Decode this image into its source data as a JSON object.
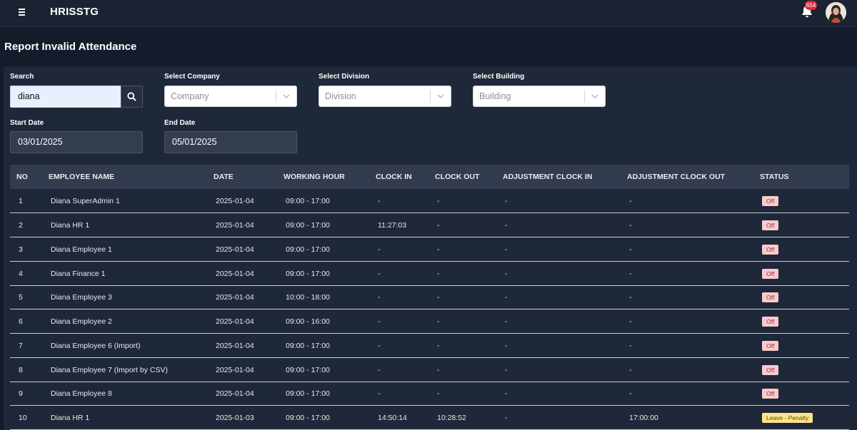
{
  "app": {
    "title": "HRISSTG",
    "notification_count": "654"
  },
  "page": {
    "title": "Report Invalid Attendance"
  },
  "filters": {
    "search": {
      "label": "Search",
      "value": "diana"
    },
    "company": {
      "label": "Select Company",
      "placeholder": "Company"
    },
    "division": {
      "label": "Select Division",
      "placeholder": "Division"
    },
    "building": {
      "label": "Select Building",
      "placeholder": "Building"
    },
    "start_date": {
      "label": "Start Date",
      "value": "03/01/2025"
    },
    "end_date": {
      "label": "End Date",
      "value": "05/01/2025"
    }
  },
  "table": {
    "columns": [
      "NO",
      "EMPLOYEE NAME",
      "DATE",
      "WORKING HOUR",
      "CLOCK IN",
      "CLOCK OUT",
      "ADJUSTMENT CLOCK IN",
      "ADJUSTMENT CLOCK OUT",
      "STATUS"
    ],
    "rows": [
      {
        "no": "1",
        "name": "Diana SuperAdmin 1",
        "date": "2025-01-04",
        "working_hour": "09:00 - 17:00",
        "clock_in": "-",
        "clock_out": "-",
        "adj_in": "-",
        "adj_out": "-",
        "status": "Off",
        "status_type": "off"
      },
      {
        "no": "2",
        "name": "Diana HR 1",
        "date": "2025-01-04",
        "working_hour": "09:00 - 17:00",
        "clock_in": "11:27:03",
        "clock_out": "-",
        "adj_in": "-",
        "adj_out": "-",
        "status": "Off",
        "status_type": "off"
      },
      {
        "no": "3",
        "name": "Diana Employee 1",
        "date": "2025-01-04",
        "working_hour": "09:00 - 17:00",
        "clock_in": "-",
        "clock_out": "-",
        "adj_in": "-",
        "adj_out": "-",
        "status": "Off",
        "status_type": "off"
      },
      {
        "no": "4",
        "name": "Diana Finance 1",
        "date": "2025-01-04",
        "working_hour": "09:00 - 17:00",
        "clock_in": "-",
        "clock_out": "-",
        "adj_in": "-",
        "adj_out": "-",
        "status": "Off",
        "status_type": "off"
      },
      {
        "no": "5",
        "name": "Diana Employee 3",
        "date": "2025-01-04",
        "working_hour": "10:00 - 18:00",
        "clock_in": "-",
        "clock_out": "-",
        "adj_in": "-",
        "adj_out": "-",
        "status": "Off",
        "status_type": "off"
      },
      {
        "no": "6",
        "name": "Diana Employee 2",
        "date": "2025-01-04",
        "working_hour": "09:00 - 16:00",
        "clock_in": "-",
        "clock_out": "-",
        "adj_in": "-",
        "adj_out": "-",
        "status": "Off",
        "status_type": "off"
      },
      {
        "no": "7",
        "name": "Diana Employee 6 (Import)",
        "date": "2025-01-04",
        "working_hour": "09:00 - 17:00",
        "clock_in": "-",
        "clock_out": "-",
        "adj_in": "-",
        "adj_out": "-",
        "status": "Off",
        "status_type": "off"
      },
      {
        "no": "8",
        "name": "Diana Employee 7 (Import by CSV)",
        "date": "2025-01-04",
        "working_hour": "09:00 - 17:00",
        "clock_in": "-",
        "clock_out": "-",
        "adj_in": "-",
        "adj_out": "-",
        "status": "Off",
        "status_type": "off"
      },
      {
        "no": "9",
        "name": "Diana Employee 8",
        "date": "2025-01-04",
        "working_hour": "09:00 - 17:00",
        "clock_in": "-",
        "clock_out": "-",
        "adj_in": "-",
        "adj_out": "-",
        "status": "Off",
        "status_type": "off"
      },
      {
        "no": "10",
        "name": "Diana HR 1",
        "date": "2025-01-03",
        "working_hour": "09:00 - 17:00",
        "clock_in": "14:50:14",
        "clock_out": "10:28:52",
        "adj_in": "-",
        "adj_out": "17:00:00",
        "status": "Leave - Penalty",
        "status_type": "leave"
      }
    ]
  },
  "colors": {
    "background": "#141c2b",
    "panel": "#1f2838",
    "header_row": "#323c4e",
    "badge_off": "#f6cbd0",
    "badge_leave": "#fbe58a",
    "notification": "#e0293c"
  },
  "icons": [
    "menu-icon",
    "bell-icon",
    "avatar",
    "search-icon",
    "chevron-down-icon"
  ]
}
